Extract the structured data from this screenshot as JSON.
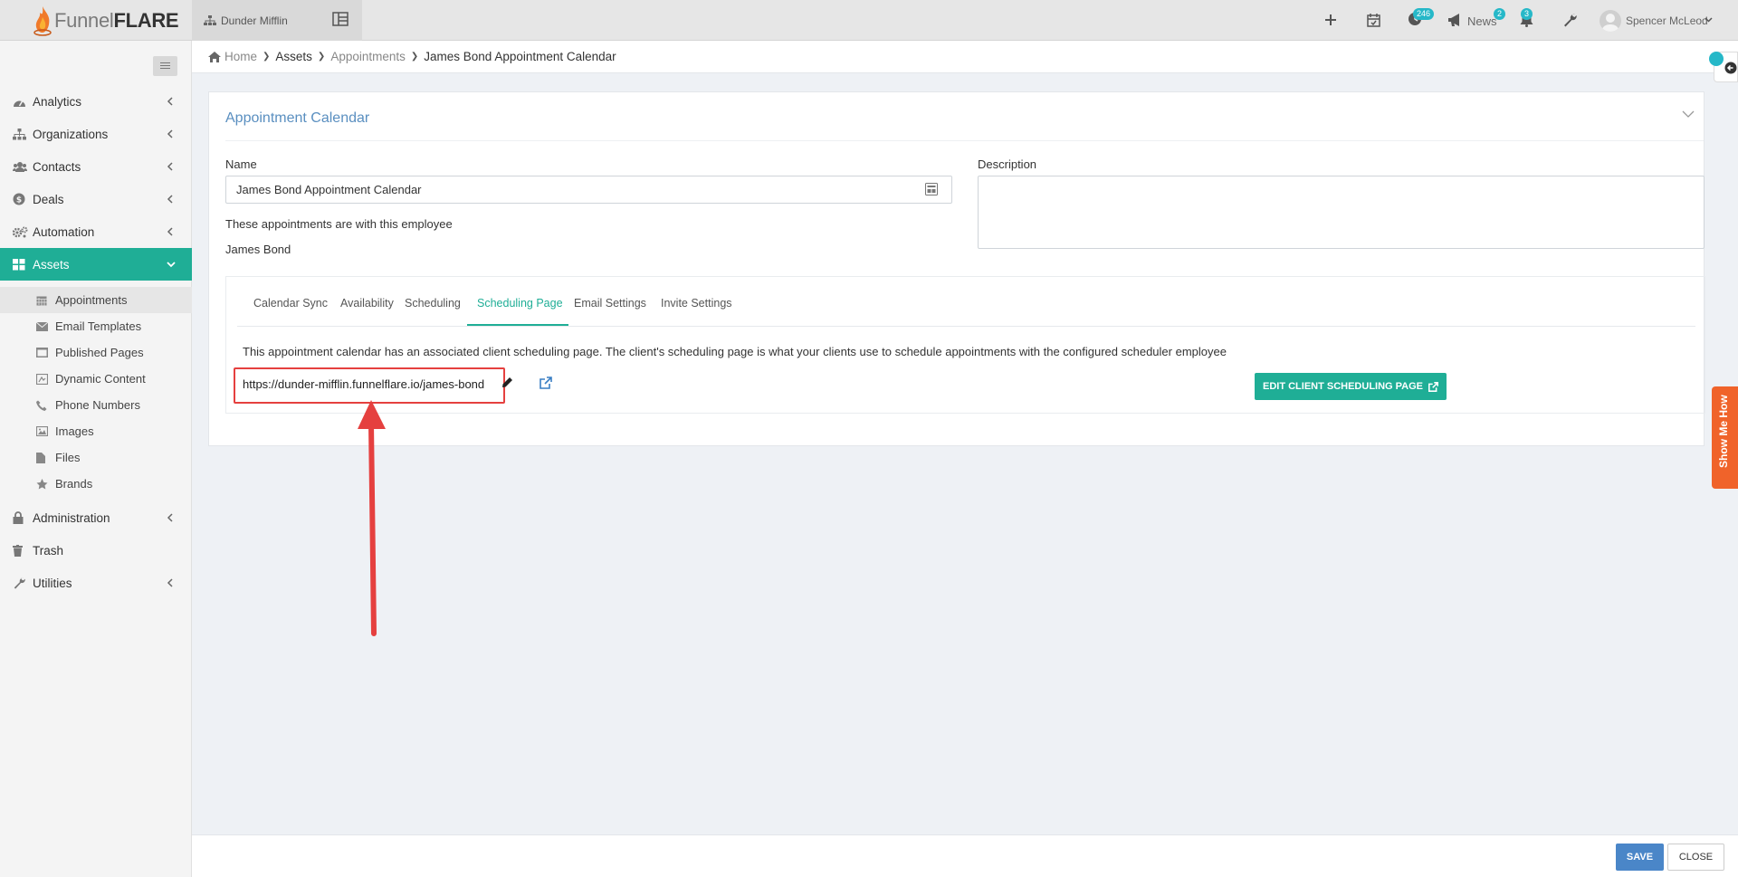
{
  "app": {
    "brand_part1": "Funnel",
    "brand_part2": "FLARE",
    "org_name": "Dunder Mifflin"
  },
  "topbar": {
    "tasks_badge": "246",
    "news_label": "News",
    "news_badge": "2",
    "notifications_badge": "3",
    "user_name": "Spencer McLeod"
  },
  "sidebar": {
    "items": [
      {
        "label": "Analytics",
        "icon": "dashboard-icon"
      },
      {
        "label": "Organizations",
        "icon": "sitemap-icon"
      },
      {
        "label": "Contacts",
        "icon": "users-icon"
      },
      {
        "label": "Deals",
        "icon": "dollar-icon"
      },
      {
        "label": "Automation",
        "icon": "cogs-icon"
      },
      {
        "label": "Assets",
        "icon": "grid-icon"
      },
      {
        "label": "Administration",
        "icon": "lock-icon"
      },
      {
        "label": "Trash",
        "icon": "trash-icon"
      },
      {
        "label": "Utilities",
        "icon": "wrench-icon"
      }
    ],
    "sub_items": [
      {
        "label": "Appointments",
        "icon": "calendar-icon"
      },
      {
        "label": "Email Templates",
        "icon": "envelope-icon"
      },
      {
        "label": "Published Pages",
        "icon": "page-icon"
      },
      {
        "label": "Dynamic Content",
        "icon": "dynamic-icon"
      },
      {
        "label": "Phone Numbers",
        "icon": "phone-icon"
      },
      {
        "label": "Images",
        "icon": "image-icon"
      },
      {
        "label": "Files",
        "icon": "file-icon"
      },
      {
        "label": "Brands",
        "icon": "star-icon"
      }
    ]
  },
  "breadcrumb": {
    "home": "Home",
    "assets": "Assets",
    "appointments": "Appointments",
    "current": "James Bond Appointment Calendar"
  },
  "card": {
    "title": "Appointment Calendar",
    "name_label": "Name",
    "name_value": "James Bond Appointment Calendar",
    "description_label": "Description",
    "description_value": "",
    "employee_label": "These appointments are with this employee",
    "employee_name": "James Bond"
  },
  "tabs": [
    "Calendar Sync",
    "Availability",
    "Scheduling",
    "Scheduling Page",
    "Email Settings",
    "Invite Settings"
  ],
  "active_tab": "Scheduling Page",
  "scheduling_page": {
    "info": "This appointment calendar has an associated client scheduling page. The client's scheduling page is what your clients use to schedule appointments with the configured scheduler employee",
    "url": "https://dunder-mifflin.funnelflare.io/james-bond",
    "edit_button": "EDIT CLIENT SCHEDULING PAGE"
  },
  "show_me_how": "Show Me How",
  "footer": {
    "save": "SAVE",
    "close": "CLOSE"
  },
  "colors": {
    "accent": "#1fae96",
    "primary": "#4a86c8",
    "highlight": "#e5403f",
    "orange": "#f0632a"
  }
}
